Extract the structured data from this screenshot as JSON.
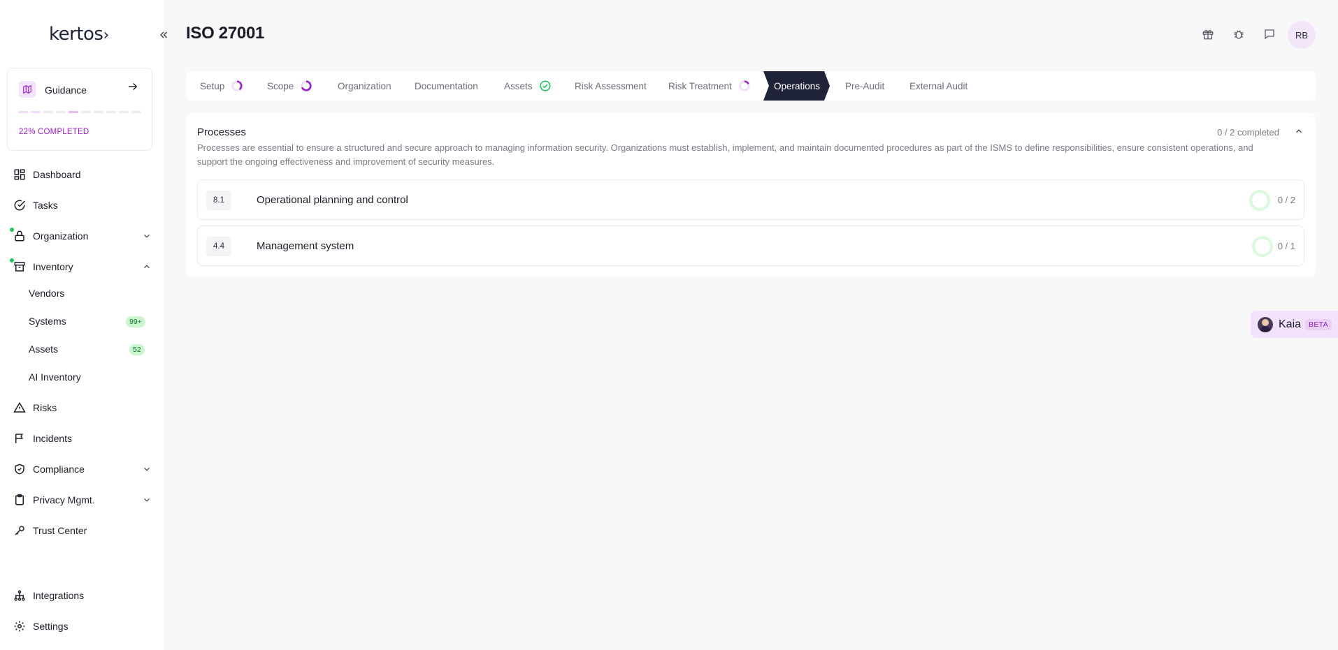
{
  "sidebar": {
    "logo": "Kertos",
    "guidance": {
      "label": "Guidance",
      "progress_label": "22% COMPLETED",
      "progress_percent": 22,
      "segments": [
        {
          "color": "#f3d9fb"
        },
        {
          "color": "#f3d9fb"
        },
        {
          "color": "#ececf0"
        },
        {
          "color": "#ececf0"
        },
        {
          "color": "#e4b8f4"
        },
        {
          "color": "#ececf0"
        },
        {
          "color": "#ececf0"
        },
        {
          "color": "#ececf0"
        },
        {
          "color": "#ececf0"
        },
        {
          "color": "#ececf0"
        }
      ]
    },
    "nav": {
      "dashboard": "Dashboard",
      "tasks": "Tasks",
      "organization": "Organization",
      "inventory": "Inventory",
      "vendors": "Vendors",
      "systems": "Systems",
      "systems_badge": "99+",
      "assets": "Assets",
      "assets_badge": "52",
      "ai_inventory": "AI Inventory",
      "risks": "Risks",
      "incidents": "Incidents",
      "compliance": "Compliance",
      "privacy": "Privacy Mgmt.",
      "trust_center": "Trust Center",
      "integrations": "Integrations",
      "settings": "Settings"
    }
  },
  "header": {
    "title": "ISO 27001",
    "avatar_initials": "RB",
    "icons": [
      "gift-icon",
      "bug-icon",
      "chat-icon"
    ]
  },
  "steps": [
    {
      "label": "Setup",
      "status": "in-progress"
    },
    {
      "label": "Scope",
      "status": "in-progress"
    },
    {
      "label": "Organization",
      "status": "none"
    },
    {
      "label": "Documentation",
      "status": "none"
    },
    {
      "label": "Assets",
      "status": "done"
    },
    {
      "label": "Risk Assessment",
      "status": "none"
    },
    {
      "label": "Risk Treatment",
      "status": "in-progress"
    },
    {
      "label": "Operations",
      "status": "active"
    },
    {
      "label": "Pre-Audit",
      "status": "none"
    },
    {
      "label": "External Audit",
      "status": "none"
    }
  ],
  "panel": {
    "title": "Processes",
    "count": "0 / 2 completed",
    "description": "Processes are essential to ensure a structured and secure approach to managing information security. Organizations must establish, implement, and maintain documented procedures as part of the ISMS to define responsibilities, ensure consistent operations, and support the ongoing effectiveness and improvement of security measures.",
    "rows": [
      {
        "num": "8.1",
        "label": "Operational planning and control",
        "count": "0 / 2"
      },
      {
        "num": "4.4",
        "label": "Management system",
        "count": "0 / 1"
      }
    ]
  },
  "kaia": {
    "label": "Kaia",
    "badge": "BETA"
  },
  "colors": {
    "accent": "#9b22c7",
    "dark": "#1f2337",
    "success": "#1fc35c"
  }
}
